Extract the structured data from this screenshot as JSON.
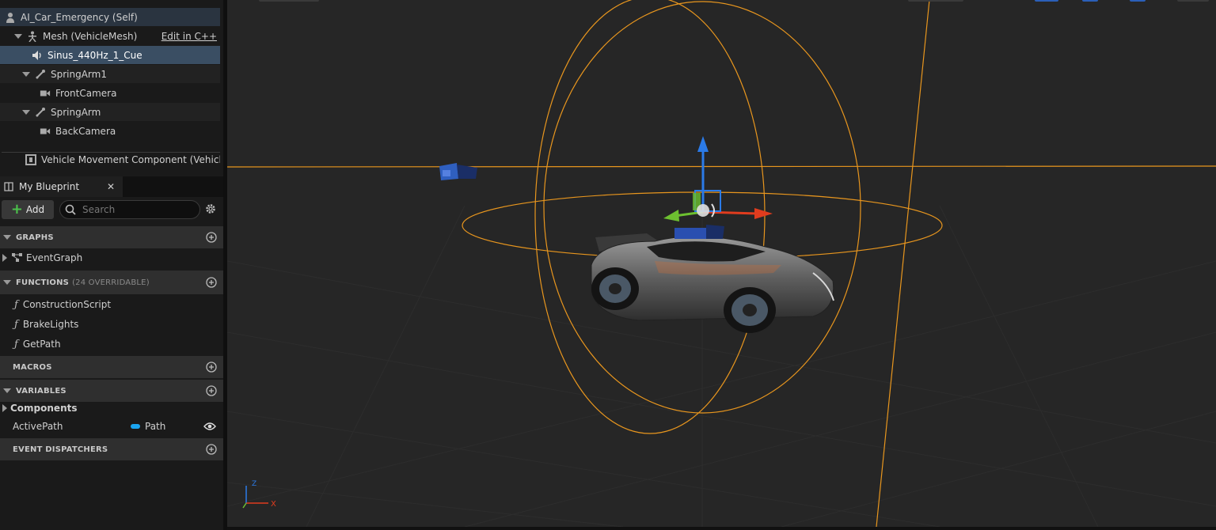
{
  "components": {
    "items": [
      {
        "label": "AI_Car_Emergency (Self)",
        "icon": "person-icon"
      },
      {
        "label": "Mesh (VehicleMesh)",
        "icon": "skeletal-mesh-icon",
        "action": "Edit in C++"
      },
      {
        "label": "Sinus_440Hz_1_Cue",
        "icon": "speaker-icon"
      },
      {
        "label": "SpringArm1",
        "icon": "spring-arm-icon"
      },
      {
        "label": "FrontCamera",
        "icon": "camera-icon"
      },
      {
        "label": "SpringArm",
        "icon": "spring-arm-icon"
      },
      {
        "label": "BackCamera",
        "icon": "camera-icon"
      },
      {
        "label": "Vehicle Movement Component (VehicleI",
        "icon": "movement-component-icon"
      }
    ]
  },
  "blueprint_panel": {
    "tab_label": "My Blueprint",
    "add_label": "Add",
    "search_placeholder": "Search",
    "sections": {
      "graphs": {
        "label": "GRAPHS",
        "items": [
          "EventGraph"
        ]
      },
      "functions": {
        "label": "FUNCTIONS",
        "sub": "(24 OVERRIDABLE)",
        "items": [
          "ConstructionScript",
          "BrakeLights",
          "GetPath"
        ]
      },
      "macros": {
        "label": "MACROS"
      },
      "variables": {
        "label": "VARIABLES",
        "category": "Components",
        "var_name": "ActivePath",
        "var_type": "Path"
      },
      "dispatchers": {
        "label": "EVENT DISPATCHERS"
      }
    }
  },
  "viewport": {
    "axis_labels": {
      "x": "X",
      "z": "Z"
    },
    "colors": {
      "selection": "#e8961e",
      "gizmo_x": "#e03c1e",
      "gizmo_y": "#6dc030",
      "gizmo_z": "#2b7be8",
      "background": "#262626"
    }
  }
}
